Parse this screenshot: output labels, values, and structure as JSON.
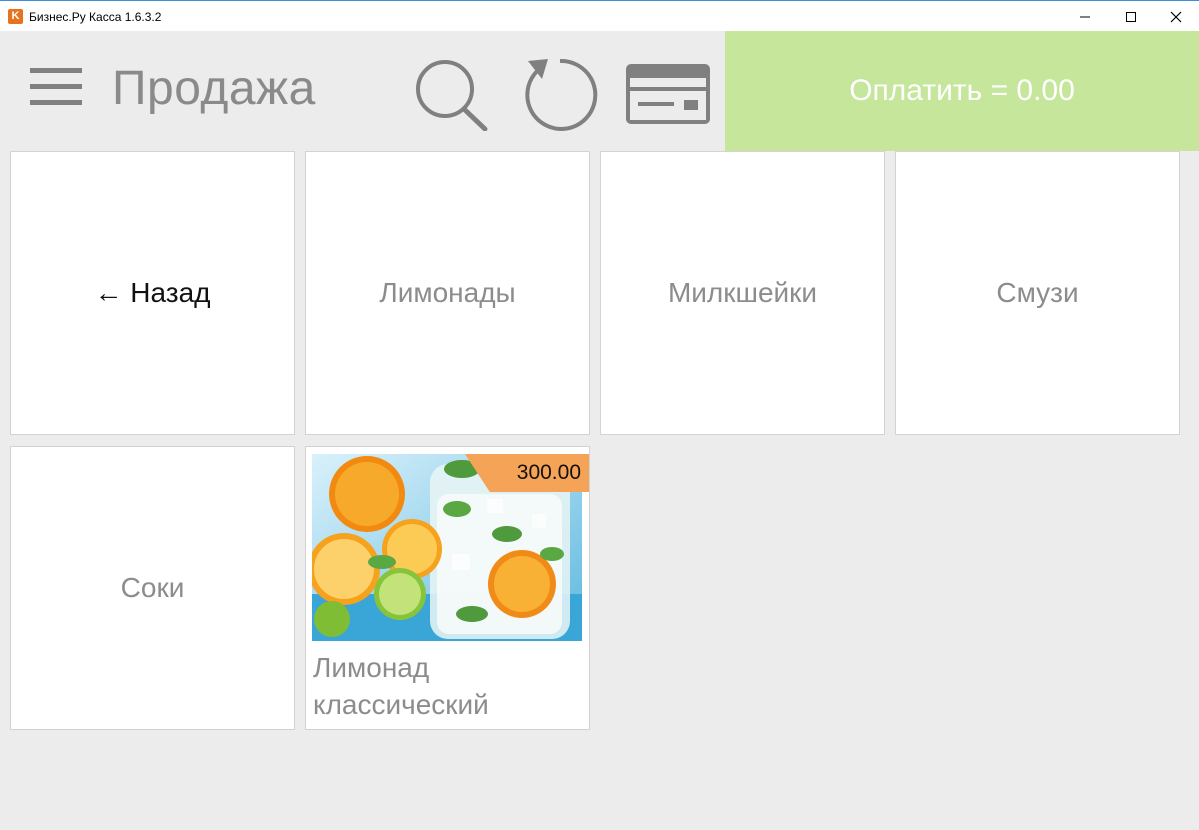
{
  "window": {
    "icon_letter": "K",
    "title": "Бизнес.Ру Касса 1.6.3.2"
  },
  "header": {
    "title": "Продажа",
    "icons": [
      "menu-icon",
      "search-icon",
      "refresh-icon",
      "card-icon"
    ],
    "pay_label": "Оплатить = 0.00"
  },
  "tiles": {
    "back": "← Назад",
    "categories": [
      "Лимонады",
      "Милкшейки",
      "Смузи",
      "Соки"
    ],
    "product": {
      "name_line1": "Лимонад",
      "name_line2": "классический",
      "price": "300.00"
    }
  },
  "colors": {
    "pay_button": "#c5e69b",
    "price_badge": "#f5a356",
    "background": "#ececec"
  }
}
